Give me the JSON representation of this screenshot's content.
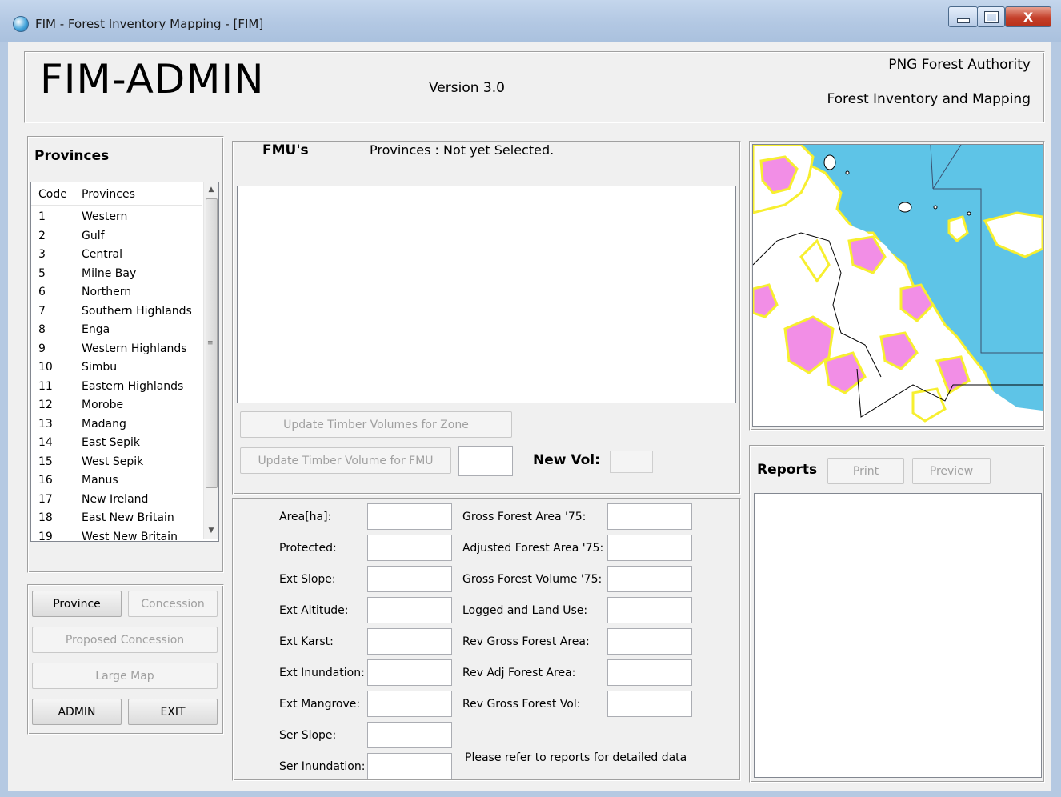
{
  "window": {
    "title": "FIM - Forest Inventory Mapping - [FIM]",
    "min_icon": "minimize-icon",
    "max_icon": "maximize-icon",
    "close_icon": "close-icon",
    "close_glyph": "X"
  },
  "header": {
    "app_title": "FIM-ADMIN",
    "version": "Version 3.0",
    "org_line1": "PNG Forest Authority",
    "org_line2": "Forest Inventory and Mapping"
  },
  "provinces": {
    "title": "Provinces",
    "columns": [
      "Code",
      "Provinces"
    ],
    "rows": [
      {
        "code": "1",
        "name": "Western"
      },
      {
        "code": "2",
        "name": "Gulf"
      },
      {
        "code": "3",
        "name": "Central"
      },
      {
        "code": "5",
        "name": "Milne Bay"
      },
      {
        "code": "6",
        "name": "Northern"
      },
      {
        "code": "7",
        "name": "Southern Highlands"
      },
      {
        "code": "8",
        "name": "Enga"
      },
      {
        "code": "9",
        "name": "Western Highlands"
      },
      {
        "code": "10",
        "name": "Simbu"
      },
      {
        "code": "11",
        "name": "Eastern Highlands"
      },
      {
        "code": "12",
        "name": "Morobe"
      },
      {
        "code": "13",
        "name": "Madang"
      },
      {
        "code": "14",
        "name": "East Sepik"
      },
      {
        "code": "15",
        "name": "West Sepik"
      },
      {
        "code": "16",
        "name": "Manus"
      },
      {
        "code": "17",
        "name": "New Ireland"
      },
      {
        "code": "18",
        "name": "East New Britain"
      },
      {
        "code": "19",
        "name": "West New Britain"
      }
    ]
  },
  "buttons": {
    "province": "Province",
    "concession": "Concession",
    "proposed_concession": "Proposed Concession",
    "large_map": "Large Map",
    "admin": "ADMIN",
    "exit": "EXIT"
  },
  "fmu": {
    "title": "FMU's",
    "status": "Provinces : Not yet Selected.",
    "update_zone": "Update Timber Volumes for Zone",
    "update_fmu": "Update Timber Volume for FMU",
    "new_vol_label": "New Vol:"
  },
  "stats": {
    "left_labels": [
      "Area[ha]:",
      "Protected:",
      "Ext Slope:",
      "Ext Altitude:",
      "Ext Karst:",
      "Ext Inundation:",
      "Ext Mangrove:",
      "Ser Slope:",
      "Ser Inundation:"
    ],
    "right_labels": [
      "Gross Forest Area '75:",
      "Adjusted Forest Area '75:",
      "Gross Forest Volume '75:",
      "Logged and Land Use:",
      "Rev Gross Forest Area:",
      "Rev Adj Forest Area:",
      "Rev Gross Forest Vol:"
    ],
    "note": "Please refer to reports for detailed data"
  },
  "reports": {
    "title": "Reports",
    "print": "Print",
    "preview": "Preview"
  },
  "colors": {
    "sea": "#5ec4e7",
    "land": "#ffffff",
    "forest_border": "#f7ef2f",
    "forest_fill": "#f28ee6"
  }
}
